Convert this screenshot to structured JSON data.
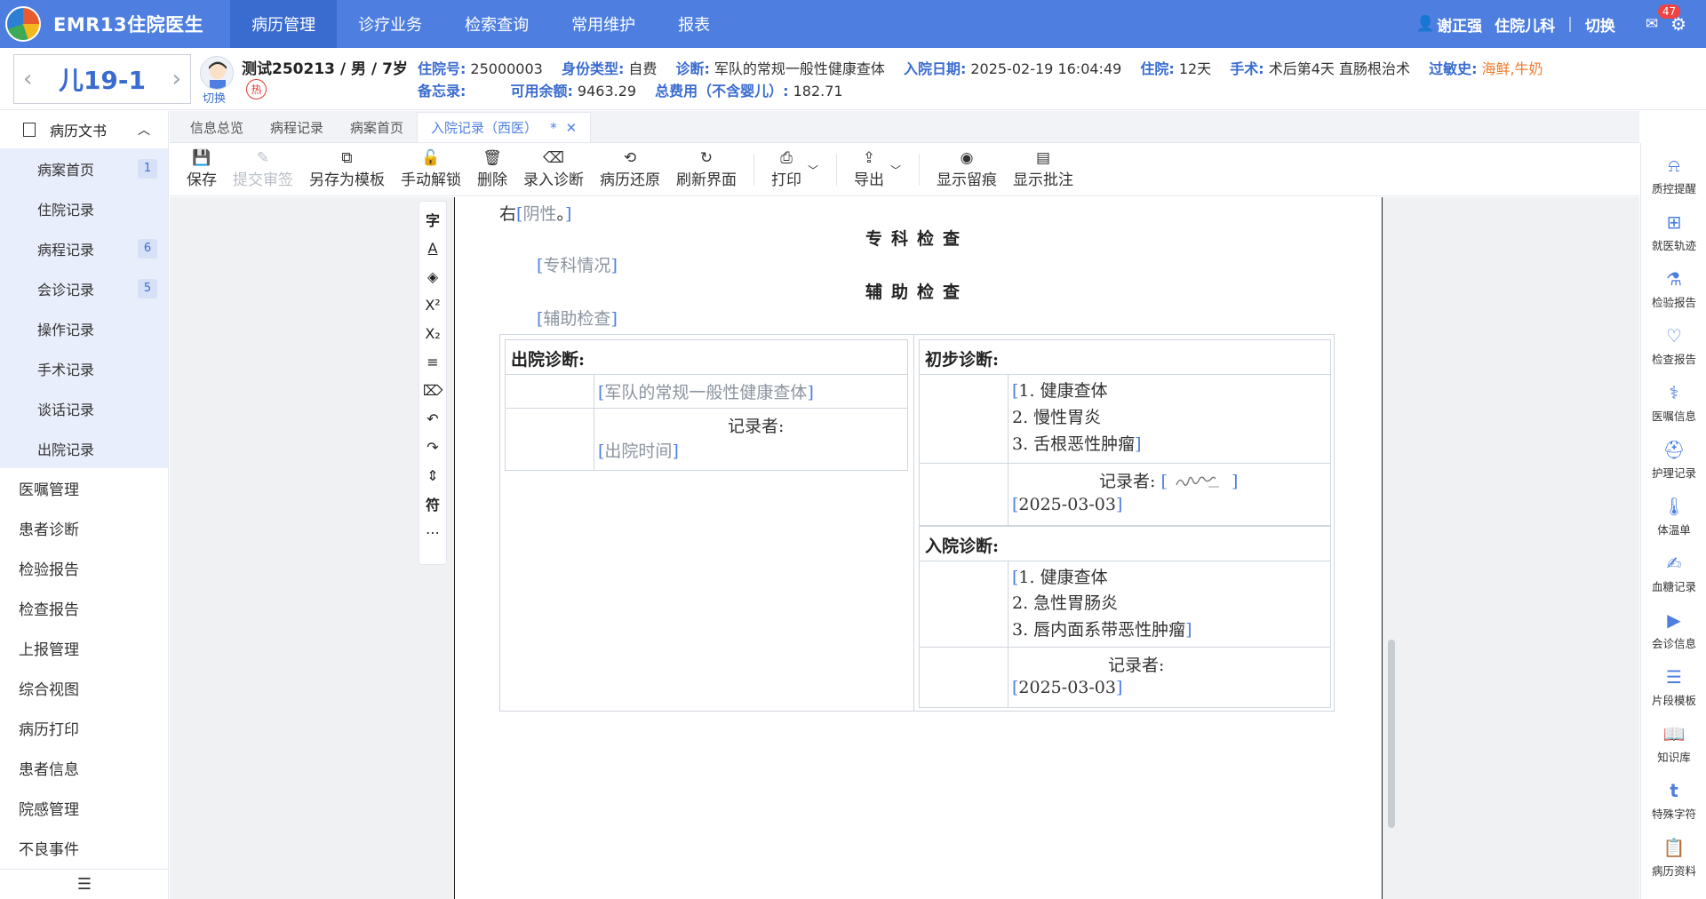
{
  "app": {
    "title": "EMR13住院医生"
  },
  "nav": [
    "病历管理",
    "诊疗业务",
    "检索查询",
    "常用维护",
    "报表"
  ],
  "user": {
    "name": "谢正强",
    "dept": "住院儿科",
    "switch": "切换",
    "mail_count": "47"
  },
  "patient": {
    "bed": "儿19-1",
    "name_line": "测试250213 / 男 / 7岁",
    "switch_label": "切换",
    "hot_badge": "热",
    "fields": {
      "admission_no_label": "住院号:",
      "admission_no": "25000003",
      "id_type_label": "身份类型:",
      "id_type": "自费",
      "diagnosis_label": "诊断:",
      "diagnosis": "军队的常规一般性健康查体",
      "admit_date_label": "入院日期:",
      "admit_date": "2025-02-19 16:04:49",
      "stay_label": "住院:",
      "stay": "12天",
      "surgery_label": "手术:",
      "surgery": "术后第4天 直肠根治术",
      "allergy_label": "过敏史:",
      "allergy": "海鲜,牛奶",
      "memo_label": "备忘录:",
      "memo": "",
      "balance_label": "可用余额:",
      "balance": "9463.29",
      "total_label": "总费用（不含婴儿）:",
      "total": "182.71"
    }
  },
  "sidebar": {
    "head": "病历文书",
    "sub_items": [
      {
        "label": "病案首页",
        "count": "1"
      },
      {
        "label": "住院记录",
        "count": ""
      },
      {
        "label": "病程记录",
        "count": "6"
      },
      {
        "label": "会诊记录",
        "count": "5"
      },
      {
        "label": "操作记录",
        "count": ""
      },
      {
        "label": "手术记录",
        "count": ""
      },
      {
        "label": "谈话记录",
        "count": ""
      },
      {
        "label": "出院记录",
        "count": ""
      }
    ],
    "items": [
      "医嘱管理",
      "患者诊断",
      "检验报告",
      "检查报告",
      "上报管理",
      "综合视图",
      "病历打印",
      "患者信息",
      "院感管理",
      "不良事件"
    ]
  },
  "tabs": [
    "信息总览",
    "病程记录",
    "病案首页",
    "入院记录（西医）"
  ],
  "tab_modified": "*",
  "toolbar": [
    "保存",
    "提交审签",
    "另存为模板",
    "手动解锁",
    "删除",
    "录入诊断",
    "病历还原",
    "刷新界面",
    "打印",
    "导出",
    "显示留痕",
    "显示批注"
  ],
  "float_tools": [
    "字",
    "符"
  ],
  "document": {
    "top_text": "右",
    "top_field": "阴性",
    "top_end": "。",
    "special_title": "专科检查",
    "special_placeholder": "专科情况",
    "aux_title": "辅助检查",
    "aux_placeholder": "辅助检查",
    "discharge": {
      "title": "出院诊断:",
      "diag": "军队的常规一般性健康查体",
      "recorder": "记录者:",
      "time": "出院时间"
    },
    "initial": {
      "title": "初步诊断:",
      "lines": [
        "1. 健康查体",
        "2. 慢性胃炎",
        "3. 舌根恶性肿瘤"
      ],
      "recorder": "记录者:",
      "date": "2025-03-03"
    },
    "admit": {
      "title": "入院诊断:",
      "lines": [
        "1. 健康查体",
        "2. 急性胃肠炎",
        "3. 唇内面系带恶性肿瘤"
      ],
      "recorder": "记录者:",
      "date": "2025-03-03"
    }
  },
  "rail": [
    "质控提醒",
    "就医轨迹",
    "检验报告",
    "检查报告",
    "医嘱信息",
    "护理记录",
    "体温单",
    "血糖记录",
    "会诊信息",
    "片段模板",
    "知识库",
    "特殊字符",
    "病历资料"
  ]
}
